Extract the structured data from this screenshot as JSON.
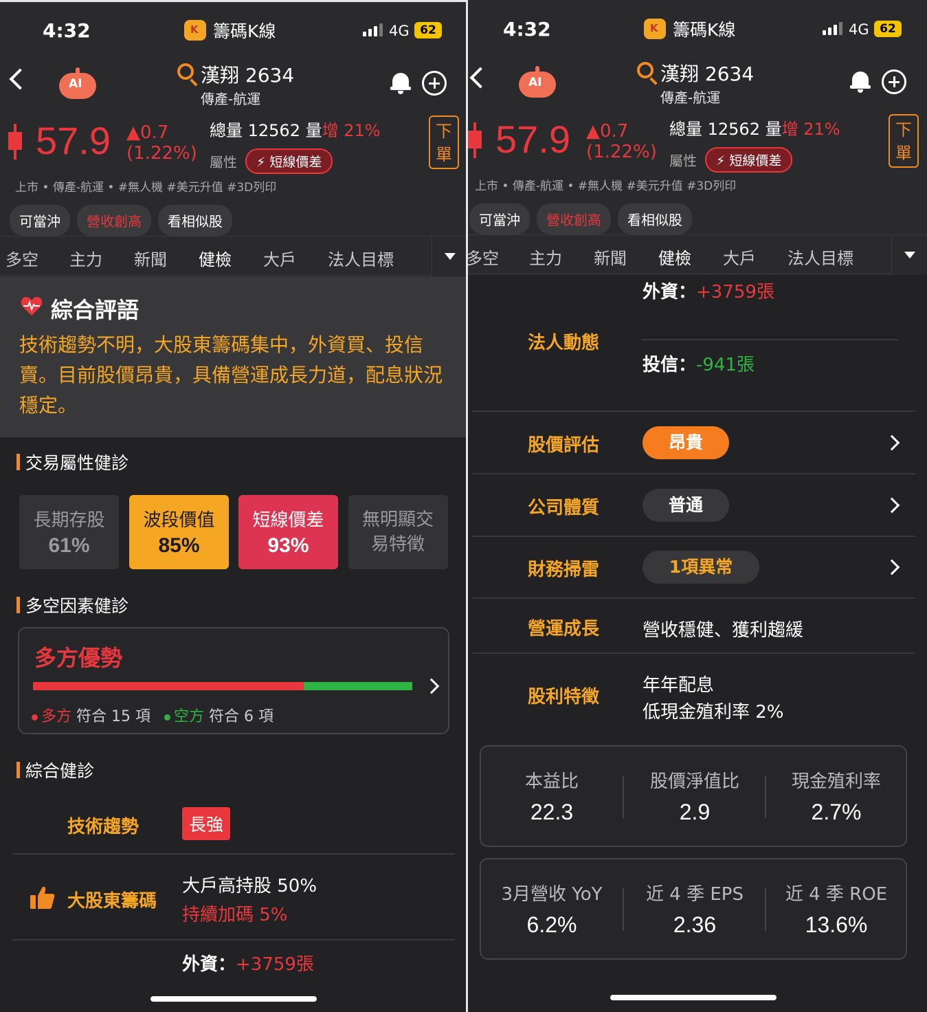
{
  "status": {
    "time": "4:32",
    "network": "4G",
    "battery": "62"
  },
  "app": {
    "title": "籌碼K線"
  },
  "stock": {
    "name": "漢翔 2634",
    "sector": "傳產-航運",
    "robot_label": "AI",
    "price": "57.9",
    "change": "▲0.7",
    "change_pct": "(1.22%)",
    "volume_prefix": "總量 12562 量",
    "volume_change": "增 21%",
    "attr_label": "屬性",
    "attr_badge": "短線價差",
    "order_label_1": "下",
    "order_label_2": "單",
    "tags": "上市 • 傳產-航運 • #無人機 #美元升值 #3D列印",
    "chips": [
      "可當沖",
      "營收創高",
      "看相似股"
    ]
  },
  "tabs": [
    "多空",
    "主力",
    "新聞",
    "健檢",
    "大戶",
    "法人目標"
  ],
  "active_tab": "健檢",
  "colors": {
    "accent": "#f5a623",
    "up": "#e8383d",
    "down": "#2fb344",
    "pill_orange": "#f57c1f"
  },
  "summary": {
    "title": "綜合評語",
    "text": "技術趨勢不明，大股東籌碼集中，外資買、投信賣。目前股價昂貴，具備營運成長力道，配息狀況穩定。"
  },
  "trade_section": {
    "title": "交易屬性健診",
    "cards": [
      {
        "label": "長期存股",
        "value": "61%"
      },
      {
        "label": "波段價值",
        "value": "85%"
      },
      {
        "label": "短線價差",
        "value": "93%"
      },
      {
        "label": "無明顯交易特徵",
        "value": ""
      }
    ]
  },
  "bull_section": {
    "title": "多空因素健診",
    "headline": "多方優勢",
    "bull_fraction": 0.714,
    "bull_name": "多方",
    "bull_text": "符合 15 項",
    "bear_name": "空方",
    "bear_text": "符合 6 項"
  },
  "overall_section": {
    "title": "綜合健診",
    "tech_label": "技術趨勢",
    "tech_value": "長強",
    "holder_label": "大股東籌碼",
    "holder_line1": "大戶高持股 50%",
    "holder_line2": "持續加碼 5%",
    "foreign_label": "外資：",
    "foreign_value": "+3759張",
    "trust_label": "投信：",
    "trust_value": "-941張",
    "inst_label": "法人動態"
  },
  "right_rows": {
    "valuation_label": "股價評估",
    "valuation_value": "昂貴",
    "quality_label": "公司體質",
    "quality_value": "普通",
    "risk_label": "財務掃雷",
    "risk_value": "1項異常",
    "growth_label": "營運成長",
    "growth_value": "營收穩健、獲利趨緩",
    "dividend_label": "股利特徵",
    "dividend_line1": "年年配息",
    "dividend_line2": "低現金殖利率 2%"
  },
  "metrics_1": [
    {
      "label": "本益比",
      "value": "22.3"
    },
    {
      "label": "股價淨值比",
      "value": "2.9"
    },
    {
      "label": "現金殖利率",
      "value": "2.7%"
    }
  ],
  "metrics_2": [
    {
      "label": "3月營收 YoY",
      "value": "6.2%"
    },
    {
      "label": "近 4 季 EPS",
      "value": "2.36"
    },
    {
      "label": "近 4 季 ROE",
      "value": "13.6%"
    }
  ]
}
